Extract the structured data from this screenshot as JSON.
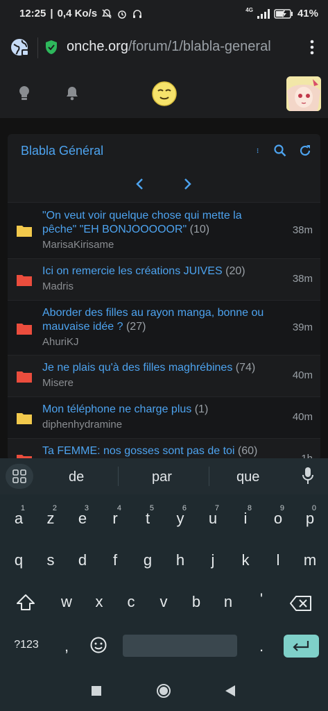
{
  "status_bar": {
    "time": "12:25",
    "speed": "0,4 Ko/s",
    "network": "4G",
    "battery": "41%"
  },
  "browser": {
    "url_host": "onche.org",
    "url_path": "/forum/1/blabla-general"
  },
  "forum": {
    "title": "Blabla Général",
    "accent_color": "#4da3ef",
    "topics": [
      {
        "title_line1": "\"On veut voir quelque chose qui mette la",
        "title_line2": "pêche\" \"EH BONJOOOOOR\"",
        "count": "(10)",
        "author": "MarisaKirisame",
        "time": "38m",
        "folder": "yellow"
      },
      {
        "title_line1": "Ici on remercie les créations JUIVES",
        "title_line2": "",
        "count": "(20)",
        "author": "Madris",
        "time": "38m",
        "folder": "red"
      },
      {
        "title_line1": "Aborder des filles au rayon manga, bonne ou",
        "title_line2": "mauvaise idée ?",
        "count": "(27)",
        "author": "AhuriKJ",
        "time": "39m",
        "folder": "red"
      },
      {
        "title_line1": "Je ne plais qu'à des filles maghrébines",
        "title_line2": "",
        "count": "(74)",
        "author": "Misere",
        "time": "40m",
        "folder": "red"
      },
      {
        "title_line1": "Mon téléphone ne charge plus",
        "title_line2": "",
        "count": "(1)",
        "author": "diphenhydramine",
        "time": "40m",
        "folder": "yellow"
      },
      {
        "title_line1": "Ta FEMME: nos gosses sont pas de toi",
        "title_line2": "",
        "count": "(60)",
        "author": "",
        "time": "1h",
        "folder": "red"
      }
    ]
  },
  "keyboard": {
    "suggestions": [
      "de",
      "par",
      "que"
    ],
    "row1": [
      "a",
      "z",
      "e",
      "r",
      "t",
      "y",
      "u",
      "i",
      "o",
      "p"
    ],
    "row1_sup": [
      "1",
      "2",
      "3",
      "4",
      "5",
      "6",
      "7",
      "8",
      "9",
      "0"
    ],
    "row2": [
      "q",
      "s",
      "d",
      "f",
      "g",
      "h",
      "j",
      "k",
      "l",
      "m"
    ],
    "row3": [
      "w",
      "x",
      "c",
      "v",
      "b",
      "n",
      "'"
    ],
    "numbers_key": "?123",
    "comma_key": ",",
    "period_key": "."
  }
}
